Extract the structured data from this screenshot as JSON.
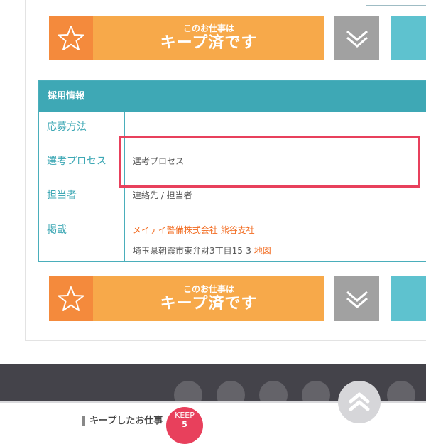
{
  "keep_button": {
    "small_text": "このお仕事は",
    "big_text": "キープ済です",
    "colors": {
      "main": "#f7a94a",
      "star_box": "#f48a3c"
    }
  },
  "icons": {
    "star": "star-icon",
    "chevrons": "double-chevron-down-icon",
    "to_top": "double-chevron-up-icon"
  },
  "recruit_info": {
    "header": "採用情報",
    "rows": [
      {
        "label": "応募方法",
        "value": ""
      },
      {
        "label": "選考プロセス",
        "value": "選考プロセス"
      },
      {
        "label": "担当者",
        "value": "連絡先 / 担当者"
      },
      {
        "label": "掲載",
        "company": "メイテイ警備株式会社 熊谷支社",
        "address": "埼玉県朝霞市東弁財3丁目15-3",
        "map_link": "地図"
      }
    ],
    "accent_color": "#3ea8b5",
    "highlight_color": "#e8405c"
  },
  "footer": {
    "kept_jobs_label": "キープしたお仕事",
    "keep_badge_label": "KEEP",
    "keep_count": "5"
  }
}
